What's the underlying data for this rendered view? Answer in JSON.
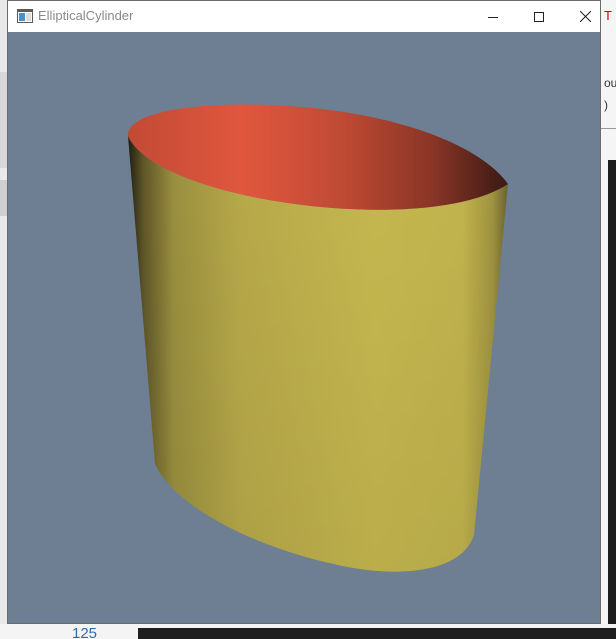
{
  "window": {
    "title": "EllipticalCylinder",
    "icon": "window-app-icon",
    "controls": [
      "minimize-icon",
      "maximize-icon",
      "close-icon"
    ]
  },
  "viewport": {
    "background_color": "#6f7f93",
    "object": "elliptical-cylinder",
    "outer_color": "#c6b84f",
    "inner_color": "#e0573e"
  },
  "background": {
    "partial_number": "125",
    "right_fragment_1": "T",
    "right_fragment_2": "ou",
    "right_fragment_3": ")"
  }
}
